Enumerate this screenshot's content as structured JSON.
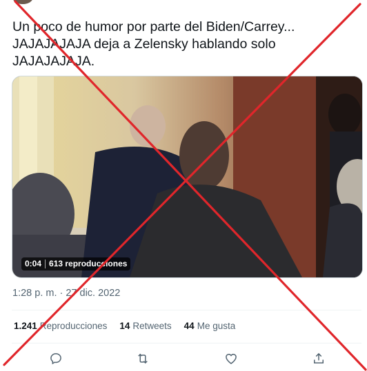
{
  "tweet": {
    "text": "Un poco de humor por parte del Biden/Carrey...\nJAJAJAJAJA deja a Zelensky hablando solo\nJAJAJAJAJA.",
    "video": {
      "duration": "0:04",
      "views_overlay": "613 reproducciones"
    },
    "timestamp": "1:28 p. m. · 27 dic. 2022",
    "stats": {
      "views_count": "1.241",
      "views_label": "Reproducciones",
      "retweets_count": "14",
      "retweets_label": "Retweets",
      "likes_count": "44",
      "likes_label": "Me gusta"
    }
  },
  "icons": {
    "reply": "reply-icon",
    "retweet": "retweet-icon",
    "like": "heart-icon",
    "share": "share-icon"
  },
  "colors": {
    "cross": "#e0262b",
    "text_secondary": "#536471"
  }
}
